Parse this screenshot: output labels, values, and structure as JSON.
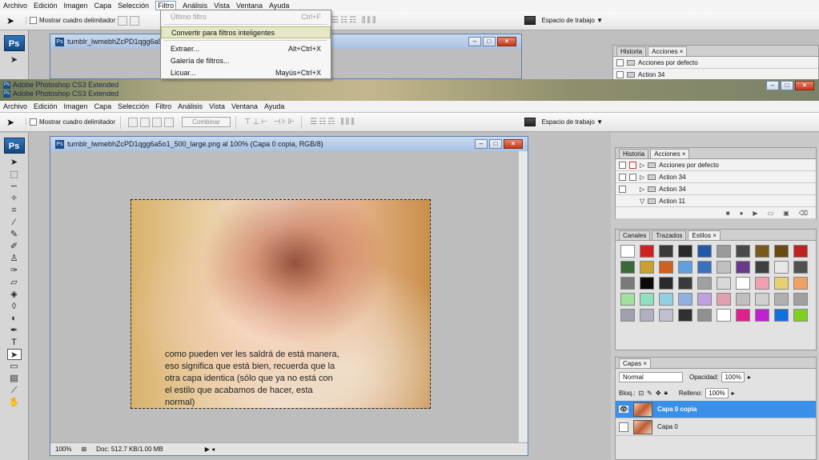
{
  "menu": [
    "Archivo",
    "Edición",
    "Imagen",
    "Capa",
    "Selección",
    "Filtro",
    "Análisis",
    "Vista",
    "Ventana",
    "Ayuda"
  ],
  "menu_active": "Filtro",
  "options": {
    "mostrar_label": "Mostrar cuadro delimitador",
    "combinar_label": "Combinar",
    "workspace_label": "Espacio de trabajo ▼"
  },
  "filter_menu": [
    {
      "label": "Último filtro",
      "shortcut": "Ctrl+F"
    },
    {
      "label": "Convertir para filtros inteligentes",
      "shortcut": ""
    },
    {
      "label": "Extraer...",
      "shortcut": "Alt+Ctrl+X"
    },
    {
      "label": "Galería de filtros...",
      "shortcut": ""
    },
    {
      "label": "Licuar...",
      "shortcut": "Mayús+Ctrl+X"
    }
  ],
  "app_title": "Adobe Photoshop CS3 Extended",
  "doc": {
    "title_short": "tumblr_lwmebhZcPD1qgg6a5c",
    "title": "tumblr_lwmebhZcPD1qgg6a5o1_500_large.png al 100% (Capa 0 copia, RGB/8)",
    "canvas_text": "como pueden ver les saldrá de está manera,\neso significa que está bien, recuerda que la\notra capa identica (sólo que ya no está con\nel estilo que acabamos de hacer, esta\nnormal)",
    "zoom": "100%",
    "doc_size": "Doc: 512.7 KB/1.00 MB"
  },
  "history_panel": {
    "tabs": [
      "Historia",
      "Acciones ×"
    ],
    "rows": [
      "Acciones por defecto",
      "Action 34",
      "Action 34",
      "Action 11"
    ]
  },
  "styles_panel": {
    "tabs": [
      "Canales",
      "Trazados",
      "Estilos ×"
    ],
    "swatch_colors": [
      "#ffffff",
      "#d02020",
      "#3a3a3a",
      "#2a2a2a",
      "#2258a8",
      "#9a9a9a",
      "#4a4a4a",
      "#7a5a1a",
      "#6a4a10",
      "#c02020",
      "#3a6a3a",
      "#c8a030",
      "#d06020",
      "#60a0e0",
      "#3a70c0",
      "#c0c0c0",
      "#6a3a8a",
      "#404040",
      "#e8e8e8",
      "#505050",
      "#7a7a7a",
      "#0a0a0a",
      "#2a2a2a",
      "#3a3a3a",
      "#a0a0a0",
      "#d8d8d8",
      "#ffffff",
      "#f0a0b0",
      "#e8d070",
      "#f0a060",
      "#a0e0a0",
      "#90e0c0",
      "#90d0e0",
      "#90b0e0",
      "#c0a0e0",
      "#e0a0b0",
      "#c0c0c0",
      "#d0d0d0",
      "#b0b0b0",
      "#a0a0a0",
      "#a0a0b0",
      "#b0b0c0",
      "#c0c0d0",
      "#303030",
      "#909090",
      "#ffffff",
      "#e02090",
      "#c020d0",
      "#1070e0",
      "#80d020"
    ]
  },
  "layers_panel": {
    "tab": "Capas ×",
    "blend_mode": "Normal",
    "opacity_label": "Opacidad:",
    "opacity_value": "100%",
    "lock_label": "Bloq.:",
    "fill_label": "Relleno:",
    "fill_value": "100%",
    "layers": [
      "Capa 0 copia",
      "Capa 0"
    ]
  }
}
